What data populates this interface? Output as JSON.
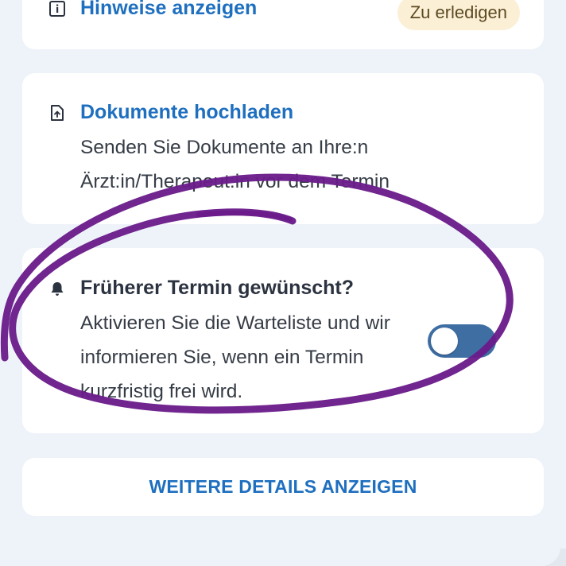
{
  "hints": {
    "title": "Hinweise anzeigen",
    "badge": "Zu erledigen",
    "icon": "info-icon"
  },
  "documents": {
    "title": "Dokumente hochladen",
    "line1": "Senden Sie Dokumente an Ihre:n",
    "line2": "Ärzt:in/Therapeut:in vor dem Termin",
    "icon": "file-upload-icon"
  },
  "waitlist": {
    "title": "Früherer Termin gewünscht?",
    "line1": "Aktivieren Sie die Warteliste und wir",
    "line2": "informieren Sie, wenn ein Termin",
    "line3": "kurzfristig frei wird.",
    "icon": "bell-icon",
    "toggle_state": "off"
  },
  "details": {
    "label": "WEITERE DETAILS ANZEIGEN"
  },
  "colors": {
    "link": "#1e6fbf",
    "annotation": "#6a1c8a",
    "badge_bg": "#fbf0d6",
    "toggle": "#3f6ea3"
  }
}
